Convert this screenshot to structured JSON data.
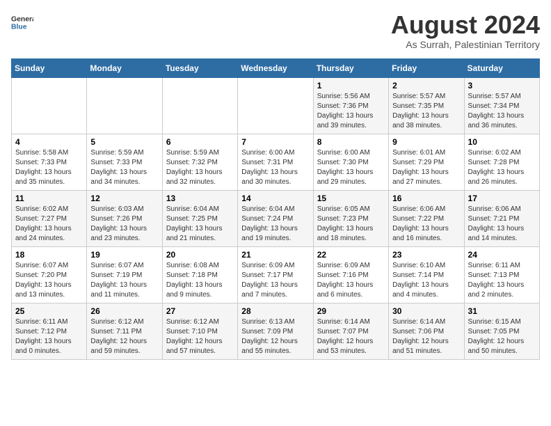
{
  "logo": {
    "general": "General",
    "blue": "Blue"
  },
  "title": "August 2024",
  "subtitle": "As Surrah, Palestinian Territory",
  "days_header": [
    "Sunday",
    "Monday",
    "Tuesday",
    "Wednesday",
    "Thursday",
    "Friday",
    "Saturday"
  ],
  "weeks": [
    [
      {
        "day": "",
        "sunrise": "",
        "sunset": "",
        "daylight": ""
      },
      {
        "day": "",
        "sunrise": "",
        "sunset": "",
        "daylight": ""
      },
      {
        "day": "",
        "sunrise": "",
        "sunset": "",
        "daylight": ""
      },
      {
        "day": "",
        "sunrise": "",
        "sunset": "",
        "daylight": ""
      },
      {
        "day": "1",
        "sunrise": "Sunrise: 5:56 AM",
        "sunset": "Sunset: 7:36 PM",
        "daylight": "Daylight: 13 hours and 39 minutes."
      },
      {
        "day": "2",
        "sunrise": "Sunrise: 5:57 AM",
        "sunset": "Sunset: 7:35 PM",
        "daylight": "Daylight: 13 hours and 38 minutes."
      },
      {
        "day": "3",
        "sunrise": "Sunrise: 5:57 AM",
        "sunset": "Sunset: 7:34 PM",
        "daylight": "Daylight: 13 hours and 36 minutes."
      }
    ],
    [
      {
        "day": "4",
        "sunrise": "Sunrise: 5:58 AM",
        "sunset": "Sunset: 7:33 PM",
        "daylight": "Daylight: 13 hours and 35 minutes."
      },
      {
        "day": "5",
        "sunrise": "Sunrise: 5:59 AM",
        "sunset": "Sunset: 7:33 PM",
        "daylight": "Daylight: 13 hours and 34 minutes."
      },
      {
        "day": "6",
        "sunrise": "Sunrise: 5:59 AM",
        "sunset": "Sunset: 7:32 PM",
        "daylight": "Daylight: 13 hours and 32 minutes."
      },
      {
        "day": "7",
        "sunrise": "Sunrise: 6:00 AM",
        "sunset": "Sunset: 7:31 PM",
        "daylight": "Daylight: 13 hours and 30 minutes."
      },
      {
        "day": "8",
        "sunrise": "Sunrise: 6:00 AM",
        "sunset": "Sunset: 7:30 PM",
        "daylight": "Daylight: 13 hours and 29 minutes."
      },
      {
        "day": "9",
        "sunrise": "Sunrise: 6:01 AM",
        "sunset": "Sunset: 7:29 PM",
        "daylight": "Daylight: 13 hours and 27 minutes."
      },
      {
        "day": "10",
        "sunrise": "Sunrise: 6:02 AM",
        "sunset": "Sunset: 7:28 PM",
        "daylight": "Daylight: 13 hours and 26 minutes."
      }
    ],
    [
      {
        "day": "11",
        "sunrise": "Sunrise: 6:02 AM",
        "sunset": "Sunset: 7:27 PM",
        "daylight": "Daylight: 13 hours and 24 minutes."
      },
      {
        "day": "12",
        "sunrise": "Sunrise: 6:03 AM",
        "sunset": "Sunset: 7:26 PM",
        "daylight": "Daylight: 13 hours and 23 minutes."
      },
      {
        "day": "13",
        "sunrise": "Sunrise: 6:04 AM",
        "sunset": "Sunset: 7:25 PM",
        "daylight": "Daylight: 13 hours and 21 minutes."
      },
      {
        "day": "14",
        "sunrise": "Sunrise: 6:04 AM",
        "sunset": "Sunset: 7:24 PM",
        "daylight": "Daylight: 13 hours and 19 minutes."
      },
      {
        "day": "15",
        "sunrise": "Sunrise: 6:05 AM",
        "sunset": "Sunset: 7:23 PM",
        "daylight": "Daylight: 13 hours and 18 minutes."
      },
      {
        "day": "16",
        "sunrise": "Sunrise: 6:06 AM",
        "sunset": "Sunset: 7:22 PM",
        "daylight": "Daylight: 13 hours and 16 minutes."
      },
      {
        "day": "17",
        "sunrise": "Sunrise: 6:06 AM",
        "sunset": "Sunset: 7:21 PM",
        "daylight": "Daylight: 13 hours and 14 minutes."
      }
    ],
    [
      {
        "day": "18",
        "sunrise": "Sunrise: 6:07 AM",
        "sunset": "Sunset: 7:20 PM",
        "daylight": "Daylight: 13 hours and 13 minutes."
      },
      {
        "day": "19",
        "sunrise": "Sunrise: 6:07 AM",
        "sunset": "Sunset: 7:19 PM",
        "daylight": "Daylight: 13 hours and 11 minutes."
      },
      {
        "day": "20",
        "sunrise": "Sunrise: 6:08 AM",
        "sunset": "Sunset: 7:18 PM",
        "daylight": "Daylight: 13 hours and 9 minutes."
      },
      {
        "day": "21",
        "sunrise": "Sunrise: 6:09 AM",
        "sunset": "Sunset: 7:17 PM",
        "daylight": "Daylight: 13 hours and 7 minutes."
      },
      {
        "day": "22",
        "sunrise": "Sunrise: 6:09 AM",
        "sunset": "Sunset: 7:16 PM",
        "daylight": "Daylight: 13 hours and 6 minutes."
      },
      {
        "day": "23",
        "sunrise": "Sunrise: 6:10 AM",
        "sunset": "Sunset: 7:14 PM",
        "daylight": "Daylight: 13 hours and 4 minutes."
      },
      {
        "day": "24",
        "sunrise": "Sunrise: 6:11 AM",
        "sunset": "Sunset: 7:13 PM",
        "daylight": "Daylight: 13 hours and 2 minutes."
      }
    ],
    [
      {
        "day": "25",
        "sunrise": "Sunrise: 6:11 AM",
        "sunset": "Sunset: 7:12 PM",
        "daylight": "Daylight: 13 hours and 0 minutes."
      },
      {
        "day": "26",
        "sunrise": "Sunrise: 6:12 AM",
        "sunset": "Sunset: 7:11 PM",
        "daylight": "Daylight: 12 hours and 59 minutes."
      },
      {
        "day": "27",
        "sunrise": "Sunrise: 6:12 AM",
        "sunset": "Sunset: 7:10 PM",
        "daylight": "Daylight: 12 hours and 57 minutes."
      },
      {
        "day": "28",
        "sunrise": "Sunrise: 6:13 AM",
        "sunset": "Sunset: 7:09 PM",
        "daylight": "Daylight: 12 hours and 55 minutes."
      },
      {
        "day": "29",
        "sunrise": "Sunrise: 6:14 AM",
        "sunset": "Sunset: 7:07 PM",
        "daylight": "Daylight: 12 hours and 53 minutes."
      },
      {
        "day": "30",
        "sunrise": "Sunrise: 6:14 AM",
        "sunset": "Sunset: 7:06 PM",
        "daylight": "Daylight: 12 hours and 51 minutes."
      },
      {
        "day": "31",
        "sunrise": "Sunrise: 6:15 AM",
        "sunset": "Sunset: 7:05 PM",
        "daylight": "Daylight: 12 hours and 50 minutes."
      }
    ]
  ]
}
